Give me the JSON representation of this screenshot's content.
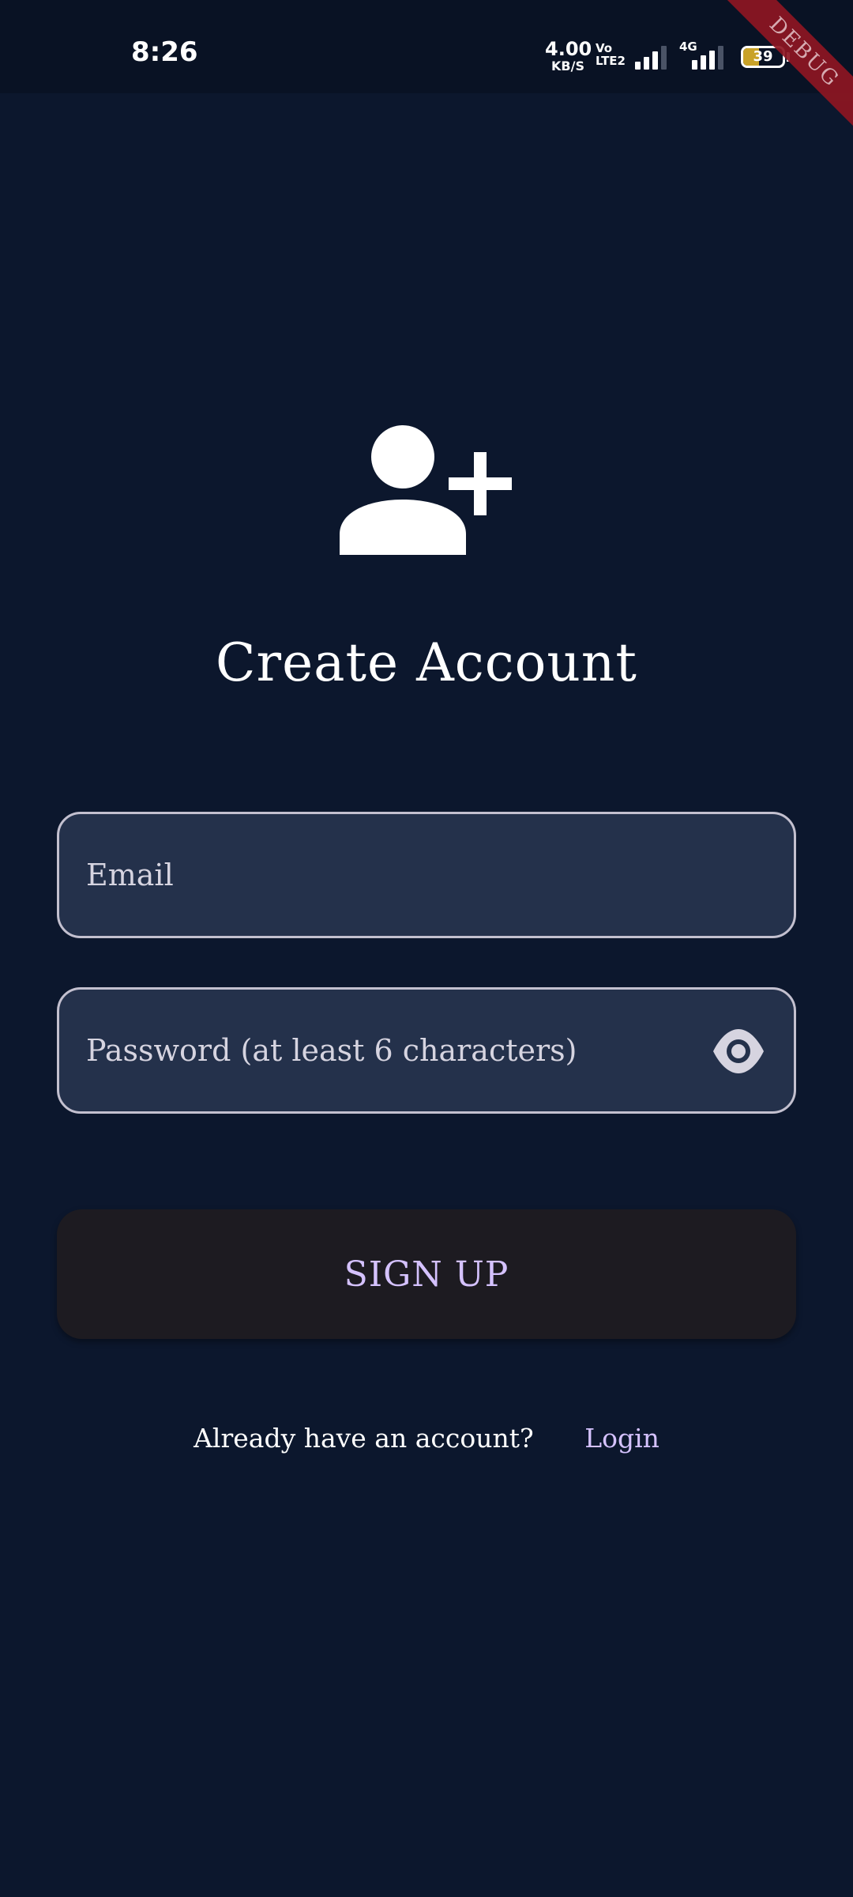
{
  "status_bar": {
    "time": "8:26",
    "net_speed_value": "4.00",
    "net_speed_unit": "KB/S",
    "volte_line1": "Vo",
    "volte_line2": "LTE2",
    "network_type": "4G",
    "battery_level": "39",
    "battery_fill_percent": 39
  },
  "debug_banner": "DEBUG",
  "header": {
    "icon": "person-add-icon",
    "title": "Create Account"
  },
  "form": {
    "email": {
      "value": "",
      "placeholder": "Email"
    },
    "password": {
      "value": "",
      "placeholder": "Password (at least 6 characters)",
      "visibility_icon": "eye-icon"
    },
    "submit_label": "SIGN UP"
  },
  "footer": {
    "prompt": "Already have an account?",
    "login_link": "Login"
  },
  "colors": {
    "background": "#0c172d",
    "field_background": "#24314b",
    "accent": "#d5c2ff",
    "button_background": "#1d1b21",
    "debug_banner": "#8e1622"
  }
}
